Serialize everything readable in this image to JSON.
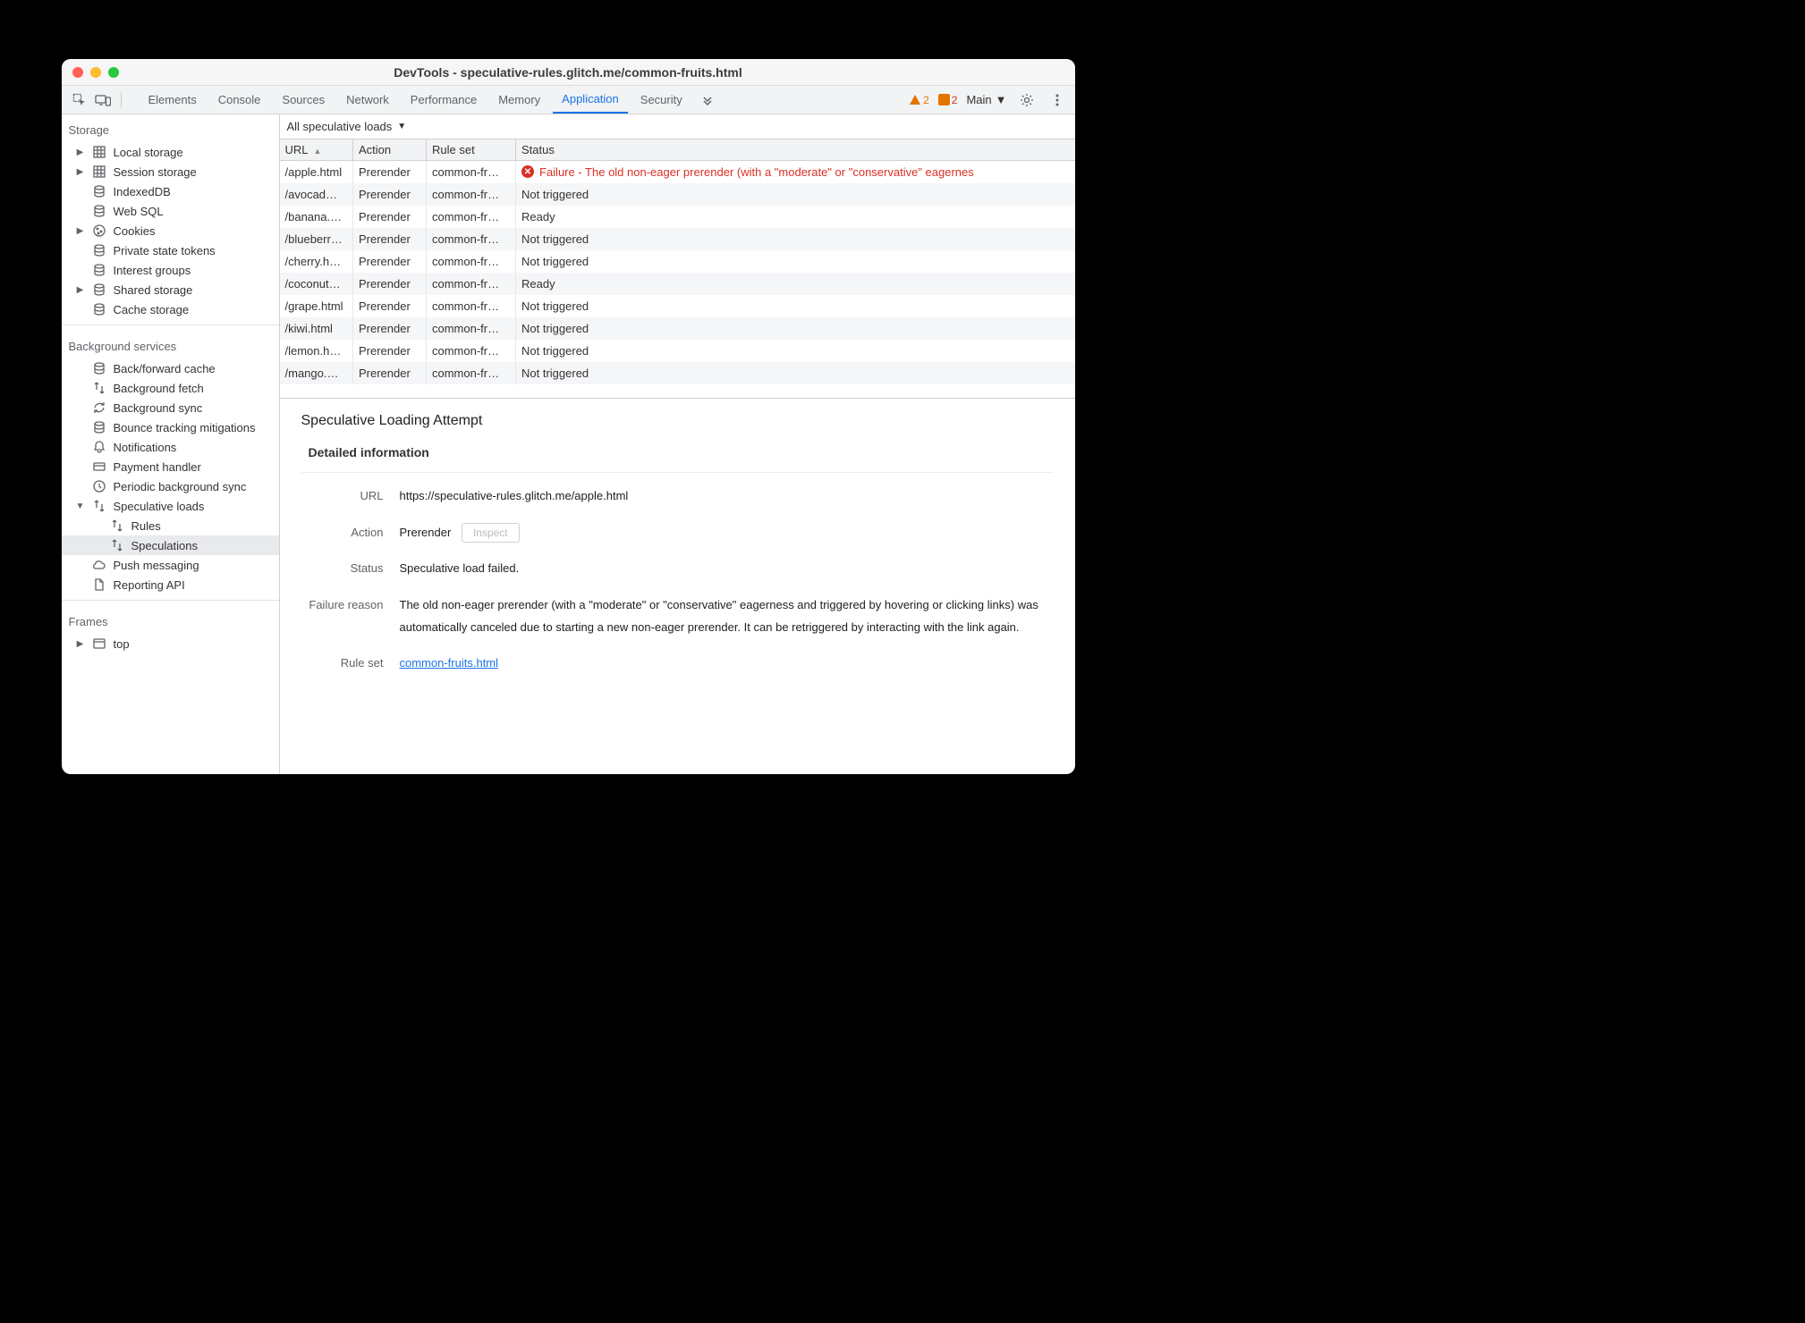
{
  "window": {
    "title": "DevTools - speculative-rules.glitch.me/common-fruits.html"
  },
  "tabs": {
    "items": [
      "Elements",
      "Console",
      "Sources",
      "Network",
      "Performance",
      "Memory",
      "Application",
      "Security"
    ],
    "active": "Application"
  },
  "warnings": "2",
  "errors": "2",
  "frame_label": "Main",
  "sidebar": {
    "storage": {
      "title": "Storage",
      "items": [
        {
          "label": "Local storage",
          "icon": "grid",
          "arrow": true
        },
        {
          "label": "Session storage",
          "icon": "grid",
          "arrow": true
        },
        {
          "label": "IndexedDB",
          "icon": "db"
        },
        {
          "label": "Web SQL",
          "icon": "db"
        },
        {
          "label": "Cookies",
          "icon": "cookie",
          "arrow": true
        },
        {
          "label": "Private state tokens",
          "icon": "db"
        },
        {
          "label": "Interest groups",
          "icon": "db"
        },
        {
          "label": "Shared storage",
          "icon": "db",
          "arrow": true
        },
        {
          "label": "Cache storage",
          "icon": "db"
        }
      ]
    },
    "bg": {
      "title": "Background services",
      "items": [
        {
          "label": "Back/forward cache",
          "icon": "db"
        },
        {
          "label": "Background fetch",
          "icon": "arrows"
        },
        {
          "label": "Background sync",
          "icon": "sync"
        },
        {
          "label": "Bounce tracking mitigations",
          "icon": "db"
        },
        {
          "label": "Notifications",
          "icon": "bell"
        },
        {
          "label": "Payment handler",
          "icon": "card"
        },
        {
          "label": "Periodic background sync",
          "icon": "clock"
        },
        {
          "label": "Speculative loads",
          "icon": "arrows",
          "arrow": true,
          "open": true
        },
        {
          "label": "Rules",
          "icon": "arrows",
          "indent": true
        },
        {
          "label": "Speculations",
          "icon": "arrows",
          "indent": true,
          "selected": true
        },
        {
          "label": "Push messaging",
          "icon": "cloud"
        },
        {
          "label": "Reporting API",
          "icon": "doc"
        }
      ]
    },
    "frames": {
      "title": "Frames",
      "items": [
        {
          "label": "top",
          "icon": "frame",
          "arrow": true
        }
      ]
    }
  },
  "filter": {
    "label": "All speculative loads"
  },
  "table": {
    "headers": [
      "URL",
      "Action",
      "Rule set",
      "Status"
    ],
    "rows": [
      {
        "url": "/apple.html",
        "action": "Prerender",
        "ruleset": "common-fr…",
        "status": "Failure - The old non-eager prerender (with a \"moderate\" or \"conservative\" eagernes",
        "failed": true
      },
      {
        "url": "/avocad…",
        "action": "Prerender",
        "ruleset": "common-fr…",
        "status": "Not triggered"
      },
      {
        "url": "/banana.…",
        "action": "Prerender",
        "ruleset": "common-fr…",
        "status": "Ready"
      },
      {
        "url": "/blueberr…",
        "action": "Prerender",
        "ruleset": "common-fr…",
        "status": "Not triggered"
      },
      {
        "url": "/cherry.h…",
        "action": "Prerender",
        "ruleset": "common-fr…",
        "status": "Not triggered"
      },
      {
        "url": "/coconut…",
        "action": "Prerender",
        "ruleset": "common-fr…",
        "status": "Ready"
      },
      {
        "url": "/grape.html",
        "action": "Prerender",
        "ruleset": "common-fr…",
        "status": "Not triggered"
      },
      {
        "url": "/kiwi.html",
        "action": "Prerender",
        "ruleset": "common-fr…",
        "status": "Not triggered"
      },
      {
        "url": "/lemon.h…",
        "action": "Prerender",
        "ruleset": "common-fr…",
        "status": "Not triggered"
      },
      {
        "url": "/mango.…",
        "action": "Prerender",
        "ruleset": "common-fr…",
        "status": "Not triggered"
      }
    ]
  },
  "detail": {
    "title": "Speculative Loading Attempt",
    "subtitle": "Detailed information",
    "url_label": "URL",
    "url_value": "https://speculative-rules.glitch.me/apple.html",
    "action_label": "Action",
    "action_value": "Prerender",
    "inspect_label": "Inspect",
    "status_label": "Status",
    "status_value": "Speculative load failed.",
    "reason_label": "Failure reason",
    "reason_value": "The old non-eager prerender (with a \"moderate\" or \"conservative\" eagerness and triggered by hovering or clicking links) was automatically canceled due to starting a new non-eager prerender. It can be retriggered by interacting with the link again.",
    "ruleset_label": "Rule set",
    "ruleset_value": "common-fruits.html"
  }
}
